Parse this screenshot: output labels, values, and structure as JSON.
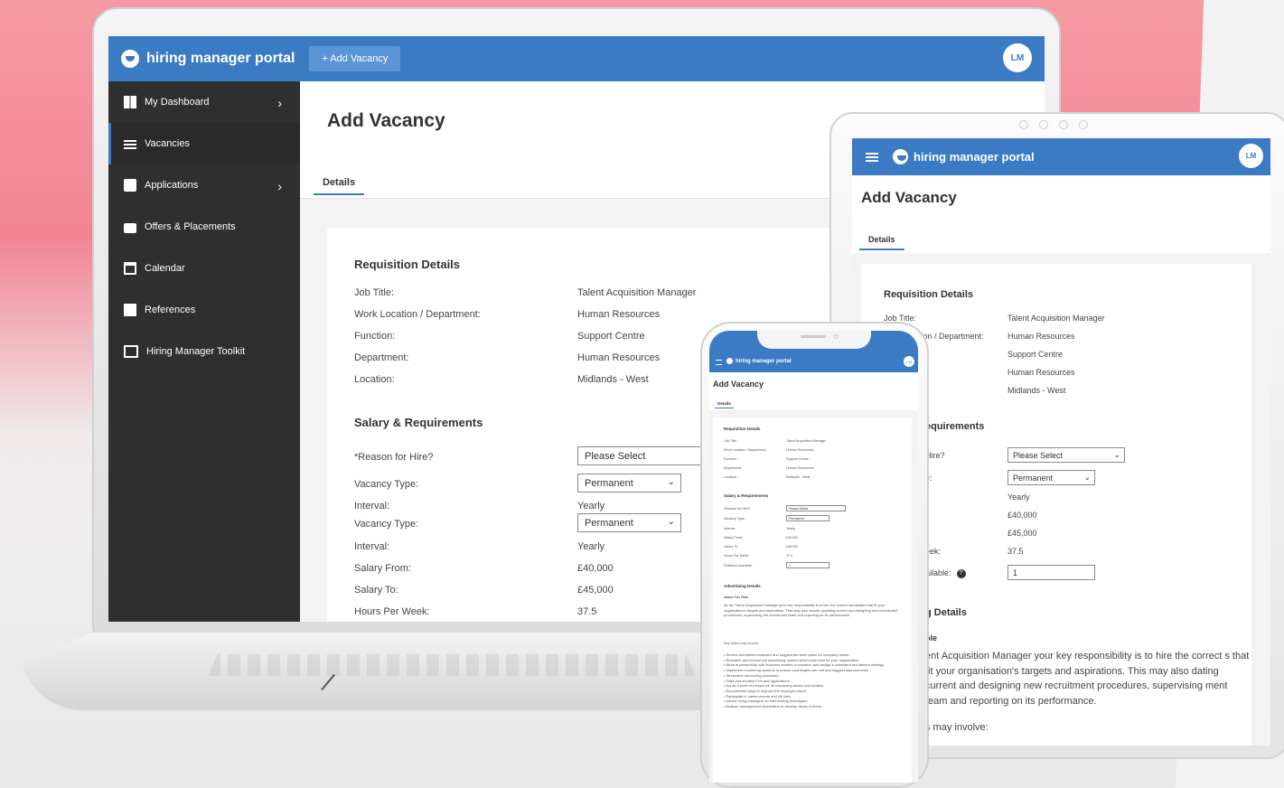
{
  "brand": {
    "name": "hiring manager portal",
    "avatar_initials": "LM"
  },
  "topbar": {
    "add_vacancy_label": "+ Add Vacancy"
  },
  "sidebar": {
    "items": [
      {
        "label": "My Dashboard",
        "icon": "dashboard-icon",
        "chevron": true
      },
      {
        "label": "Vacancies",
        "icon": "list-icon",
        "active": true
      },
      {
        "label": "Applications",
        "icon": "id-badge-icon",
        "chevron": true
      },
      {
        "label": "Offers & Placements",
        "icon": "briefcase-icon"
      },
      {
        "label": "Calendar",
        "icon": "calendar-icon"
      },
      {
        "label": "References",
        "icon": "book-icon"
      },
      {
        "label": "Hiring Manager Toolkit",
        "icon": "open-book-icon"
      }
    ]
  },
  "page": {
    "title": "Add Vacancy",
    "tab": "Details"
  },
  "requisition": {
    "title": "Requisition Details",
    "rows": [
      {
        "label": "Job Title:",
        "value": "Talent Acquisition Manager"
      },
      {
        "label": "Work Location / Department:",
        "value": "Human Resources"
      },
      {
        "label": "Function:",
        "value": "Support Centre"
      },
      {
        "label": "Department:",
        "value": "Human Resources"
      },
      {
        "label": "Location:",
        "value": "Midlands - West"
      }
    ]
  },
  "salary": {
    "title": "Salary & Requirements",
    "reason_label": "*Reason for Hire?",
    "reason_value": "Please Select",
    "vacancy_type_label": "Vacancy Type:",
    "vacancy_type_value": "Permanent",
    "interval_label": "Interval:",
    "interval_value": "Yearly",
    "salary_from_label": "Salary From:",
    "salary_from_value": "£40,000",
    "salary_to_label": "Salary To:",
    "salary_to_value": "£45,000",
    "hours_label": "Hours Per Week:",
    "hours_value": "37.5",
    "positions_label": "Positions Available:",
    "positions_value": "1"
  },
  "tablet": {
    "req_label_job": "Job Title:",
    "req_label_loc": "tion / Department:",
    "sec_salary": "equirements",
    "lbl_hire": "Hire?",
    "lbl_type": "e:",
    "lbl_week": "eek:",
    "lbl_available": "ailable:",
    "sec_adv": "g Details",
    "sub_role": "ole",
    "para": "ent Acquisition Manager your key responsibility is to hire the correct s that fit your organisation's targets and aspirations. This may also dating current and designing new recruitment procedures, supervising ment team and reporting on its performance.",
    "may_involve": "s may involve:"
  },
  "advertising": {
    "title": "Advertising Details",
    "about_label": "About The Role",
    "about_text": "As the Talent Acquisition Manager your key responsibility is to hire the correct candidates that fit your organisation's targets and aspirations. This may also include updating current and designing new recruitment procedures, supervising the recruitment team and reporting on its performance.",
    "duties_label": "Key duties may involve:",
    "duties": [
      "Review recruitment software and suggest the best option for company needs",
      "Research and choose job advertising options which work best for your organisation",
      "Work in partnership with business leaders to research and design a consistent recruitment strategy",
      "Implement monitoring systems to ensure cost targets are met and suggest improvements",
      "Streamline resourcing processes",
      "Filter and shortlist CVs and applications",
      "Act as a point of contact for all resourcing issues and matters",
      "Recommend ways to improve the employer brand",
      "Participate in career events and job fairs",
      "Advise hiring managers on interviewing techniques",
      "Analyse management information to develop areas of focus."
    ]
  }
}
